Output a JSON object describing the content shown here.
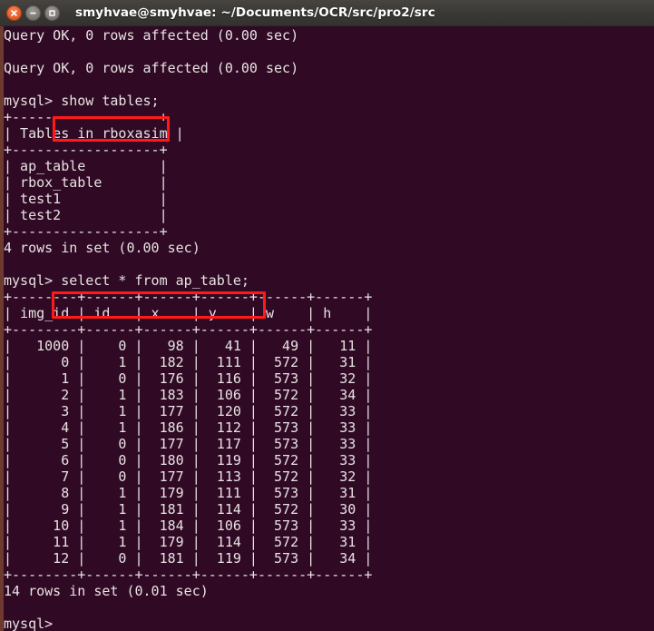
{
  "window": {
    "title": "smyhvae@smyhvae: ~/Documents/OCR/src/pro2/src",
    "controls": {
      "close_label": "x",
      "minimize_label": "−",
      "maximize_label": "□"
    },
    "colors": {
      "terminal_background": "#300a24",
      "terminal_foreground": "#e8e3e3",
      "titlebar_background": "#3b3936",
      "annotation_red": "#ff1a1a",
      "close_button": "#e8622a",
      "window_left_frame": "#6e3a2f"
    }
  },
  "terminal": {
    "lines": [
      "Query OK, 0 rows affected (0.00 sec)",
      "",
      "Query OK, 0 rows affected (0.00 sec)",
      "",
      "mysql> show tables;",
      "+------------------+",
      "| Tables_in_rboxasim |",
      "+------------------+",
      "| ap_table         |",
      "| rbox_table       |",
      "| test1            |",
      "| test2            |",
      "+------------------+",
      "4 rows in set (0.00 sec)",
      "",
      "mysql> select * from ap_table;",
      "+--------+------+------+------+------+------+",
      "| img_id | id   | x    | y    | w    | h    |",
      "+--------+------+------+------+------+------+",
      "|   1000 |    0 |   98 |   41 |   49 |   11 |",
      "|      0 |    1 |  182 |  111 |  572 |   31 |",
      "|      1 |    0 |  176 |  116 |  573 |   32 |",
      "|      2 |    1 |  183 |  106 |  572 |   34 |",
      "|      3 |    1 |  177 |  120 |  572 |   33 |",
      "|      4 |    1 |  186 |  112 |  573 |   33 |",
      "|      5 |    0 |  177 |  117 |  573 |   33 |",
      "|      6 |    0 |  180 |  119 |  572 |   33 |",
      "|      7 |    0 |  177 |  113 |  572 |   32 |",
      "|      8 |    1 |  179 |  111 |  573 |   31 |",
      "|      9 |    1 |  181 |  114 |  572 |   30 |",
      "|     10 |    1 |  184 |  106 |  573 |   33 |",
      "|     11 |    1 |  179 |  114 |  572 |   31 |",
      "|     12 |    0 |  181 |  119 |  573 |   34 |",
      "+--------+------+------+------+------+------+",
      "14 rows in set (0.01 sec)",
      "",
      "mysql>"
    ],
    "prompt": "mysql>",
    "commands": [
      "show tables;",
      "select * from ap_table;"
    ],
    "show_tables_result": {
      "header": "Tables_in_rboxasim",
      "rows": [
        "ap_table",
        "rbox_table",
        "test1",
        "test2"
      ],
      "status": "4 rows in set (0.00 sec)"
    },
    "ap_table_result": {
      "columns": [
        "img_id",
        "id",
        "x",
        "y",
        "w",
        "h"
      ],
      "rows": [
        [
          1000,
          0,
          98,
          41,
          49,
          11
        ],
        [
          0,
          1,
          182,
          111,
          572,
          31
        ],
        [
          1,
          0,
          176,
          116,
          573,
          32
        ],
        [
          2,
          1,
          183,
          106,
          572,
          34
        ],
        [
          3,
          1,
          177,
          120,
          572,
          33
        ],
        [
          4,
          1,
          186,
          112,
          573,
          33
        ],
        [
          5,
          0,
          177,
          117,
          573,
          33
        ],
        [
          6,
          0,
          180,
          119,
          572,
          33
        ],
        [
          7,
          0,
          177,
          113,
          572,
          32
        ],
        [
          8,
          1,
          179,
          111,
          573,
          31
        ],
        [
          9,
          1,
          181,
          114,
          572,
          30
        ],
        [
          10,
          1,
          184,
          106,
          573,
          33
        ],
        [
          11,
          1,
          179,
          114,
          572,
          31
        ],
        [
          12,
          0,
          181,
          119,
          573,
          34
        ]
      ],
      "status": "14 rows in set (0.01 sec)"
    },
    "preceding_status_lines": [
      "Query OK, 0 rows affected (0.00 sec)",
      "Query OK, 0 rows affected (0.00 sec)"
    ]
  },
  "annotations": [
    {
      "target": "show tables;",
      "color": "#ff1a1a"
    },
    {
      "target": "select * from ap_table;",
      "color": "#ff1a1a"
    }
  ]
}
